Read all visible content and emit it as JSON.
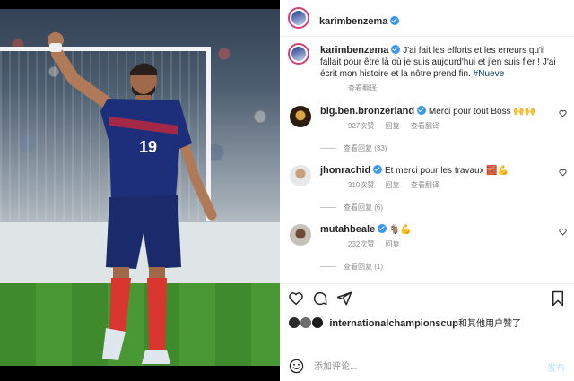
{
  "post": {
    "username": "karimbenzema",
    "caption_text": "J'ai fait les efforts et les erreurs qu'il fallait pour être là où je suis aujourd'hui et j'en suis fier ! J'ai écrit mon histoire et la nôtre prend fin.",
    "hashtag": "#Nueve",
    "translate_label": "查看翻译"
  },
  "comments": [
    {
      "username": "big.ben.bronzerland",
      "text": "Merci pour tout Boss 🙌🙌",
      "likes": "927次赞",
      "reply_label": "回复",
      "translate_label": "查看翻译",
      "view_replies": "查看回复 (33)"
    },
    {
      "username": "jhonrachid",
      "text": "Et merci pour les travaux 🧱💪",
      "likes": "310次赞",
      "reply_label": "回复",
      "translate_label": "查看翻译",
      "view_replies": "查看回复 (6)"
    },
    {
      "username": "mutahbeale",
      "text": "🐐💪",
      "likes": "232次赞",
      "reply_label": "回复",
      "translate_label": "",
      "view_replies": "查看回复 (1)"
    }
  ],
  "likes_line": {
    "user": "internationalchampionscup",
    "suffix": "和其他用户赞了"
  },
  "add_comment": {
    "placeholder": "添加评论...",
    "post_label": "发布"
  },
  "photo": {
    "jersey_number": "19"
  },
  "colors": {
    "verified": "#3897f0",
    "link": "#00376b",
    "post_button": "#b2dffc",
    "jersey_blue": "#1d2f7a",
    "socks_red": "#d8362f"
  },
  "icons": [
    "heart-icon",
    "comment-icon",
    "share-icon",
    "bookmark-icon",
    "emoji-icon",
    "verified-icon"
  ]
}
